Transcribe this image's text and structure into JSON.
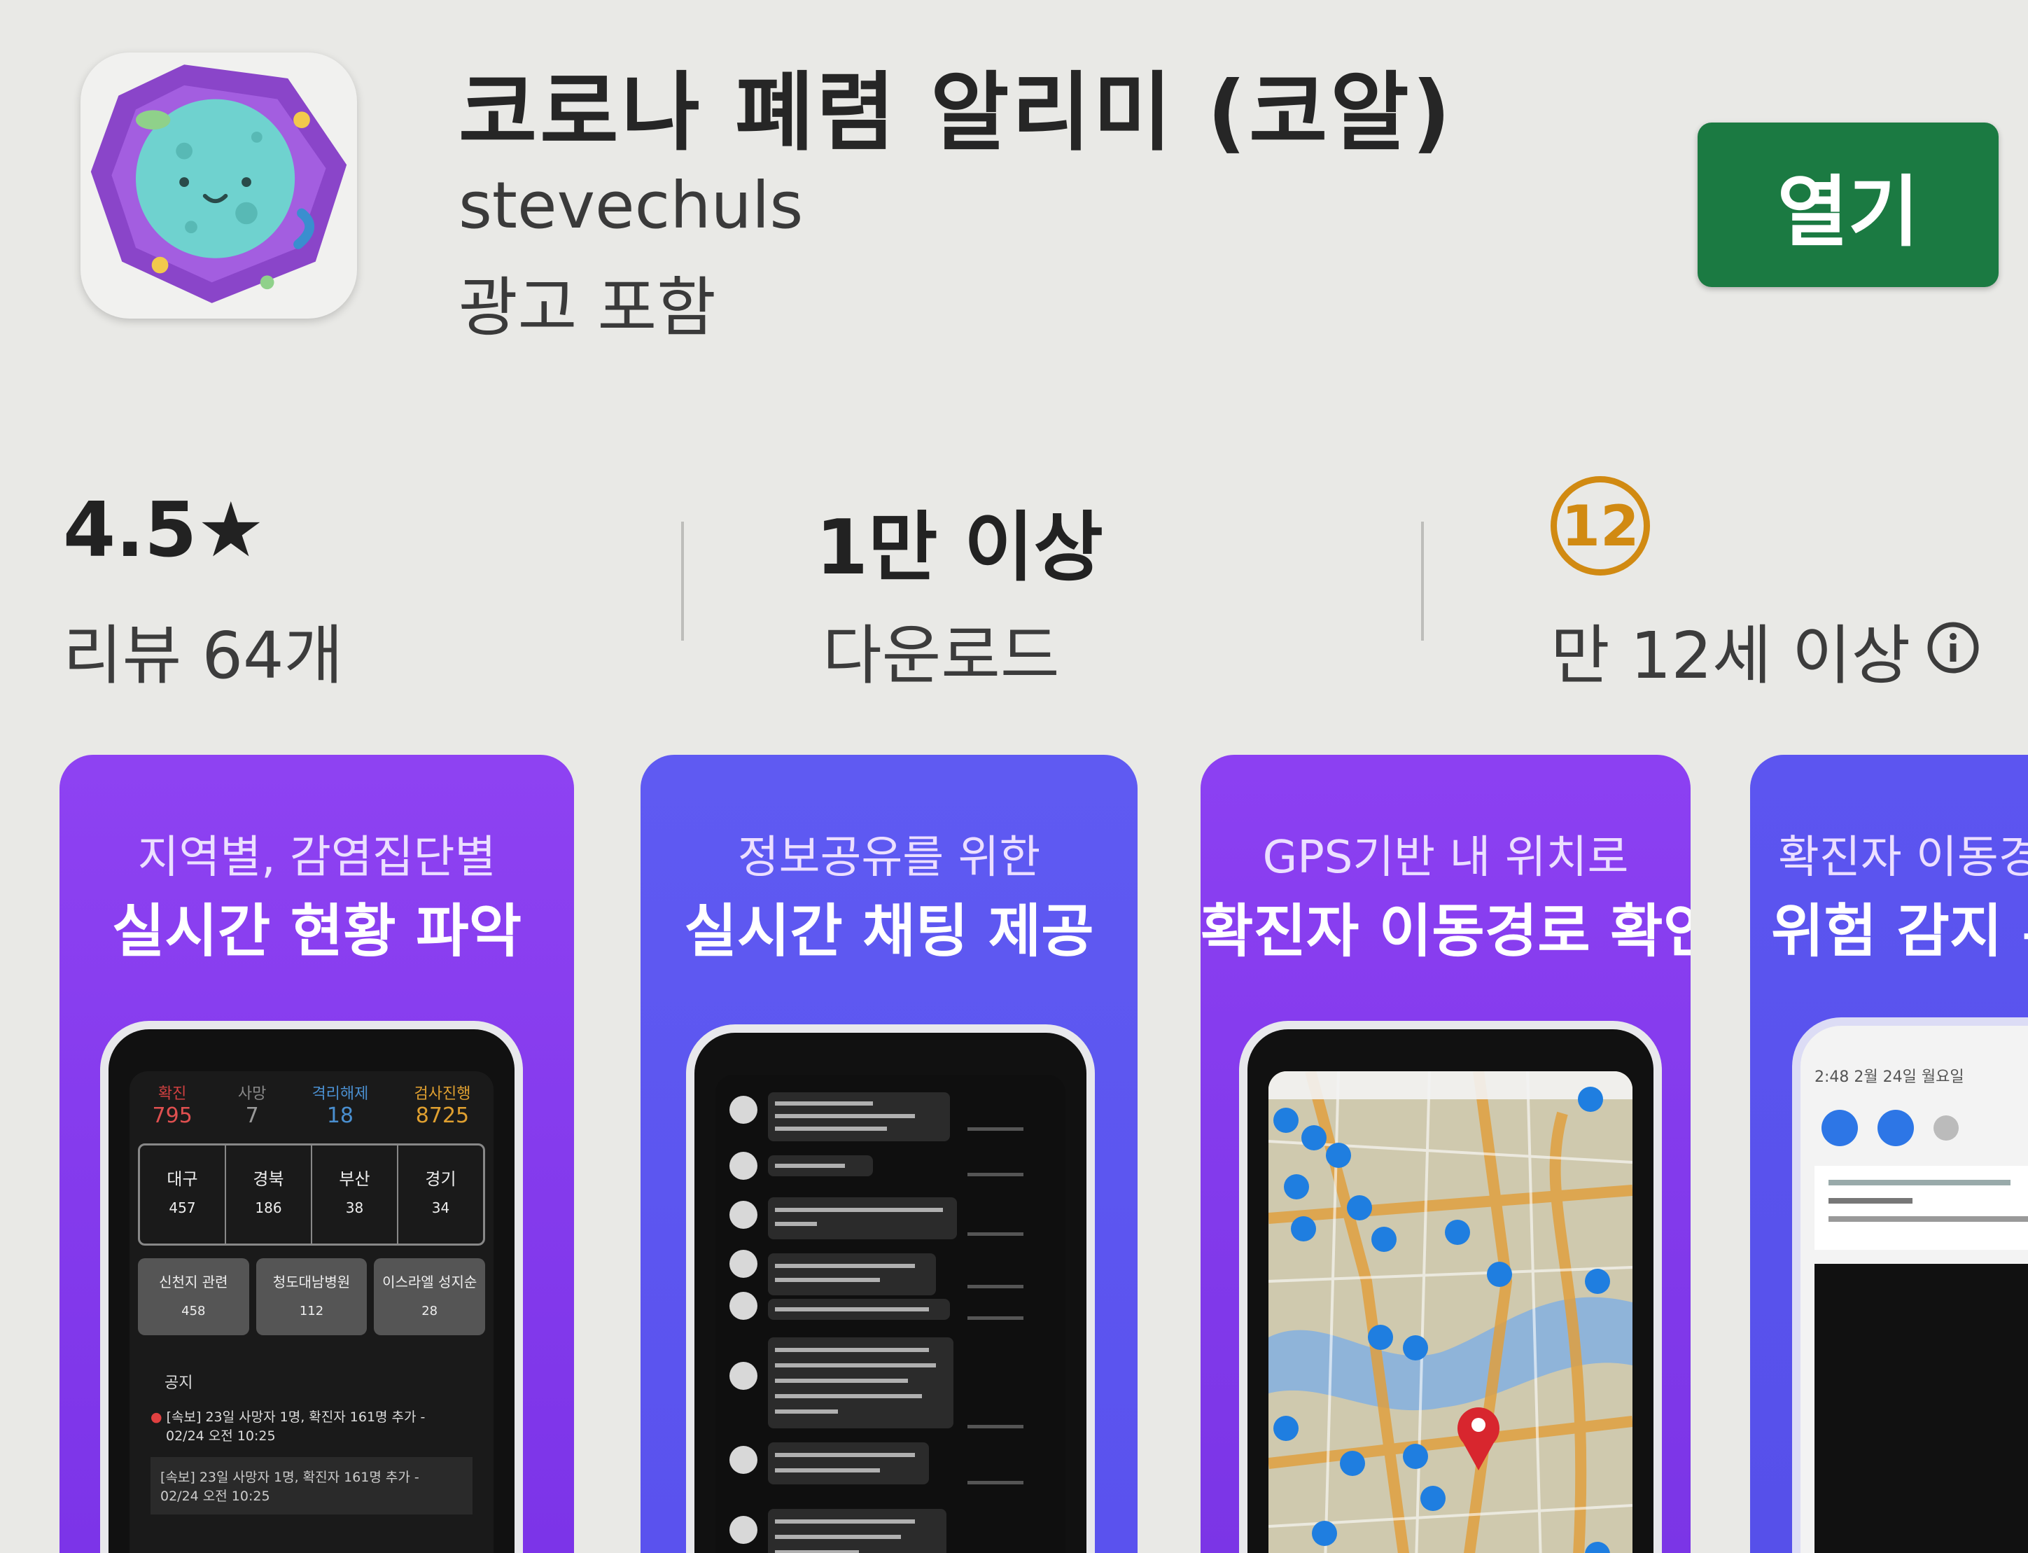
{
  "app": {
    "title": "코로나 폐렴 알리미 (코알)",
    "developer": "stevechuls",
    "ads": "광고 포함",
    "open_label": "열기",
    "icon": "virus-character-icon"
  },
  "stats": {
    "rating": "4.5★",
    "reviews": "리뷰 64개",
    "downloads": "1만 이상",
    "downloads_label": "다운로드",
    "age_badge": "12",
    "age_label": "만 12세 이상",
    "info_icon": "info-icon"
  },
  "screenshots": [
    {
      "caption_small": "지역별, 감염집단별",
      "caption_large": "실시간 현황 파악"
    },
    {
      "caption_small": "정보공유를 위한",
      "caption_large": "실시간 채팅 제공"
    },
    {
      "caption_small": "GPS기반 내 위치로",
      "caption_large": "확진자 이동경로 확인"
    },
    {
      "caption_small": "확진자 이동경",
      "caption_large": "위험 감지 푸"
    }
  ],
  "dashboard": {
    "top_labels": [
      "확진",
      "사망",
      "격리해제",
      "검사진행"
    ],
    "top_values": [
      "795",
      "7",
      "18",
      "8725"
    ],
    "regions": [
      {
        "name": "대구",
        "count": "457"
      },
      {
        "name": "경북",
        "count": "186"
      },
      {
        "name": "부산",
        "count": "38"
      },
      {
        "name": "경기",
        "count": "34"
      }
    ],
    "groups": [
      {
        "name": "신천지 관련",
        "count": "458"
      },
      {
        "name": "청도대남병원",
        "count": "112"
      },
      {
        "name": "이스라엘 성지순",
        "count": "28"
      }
    ],
    "notice_title": "공지",
    "notice_1": "[속보] 23일 사망자 1명, 확진자 161명 추가 -",
    "notice_1_time": "02/24 오전 10:25",
    "notice_2": "[속보] 23일 사망자 1명, 확진자 161명 추가 -",
    "notice_2_time": "02/24 오전 10:25"
  },
  "status_panel": {
    "time": "2:48  2월 24일 월요일"
  },
  "colors": {
    "open_button": "#1b7a42",
    "age_badge": "#d18a12",
    "screenshot_purple": "#8a3df0",
    "screenshot_blue": "#5b55ef"
  }
}
